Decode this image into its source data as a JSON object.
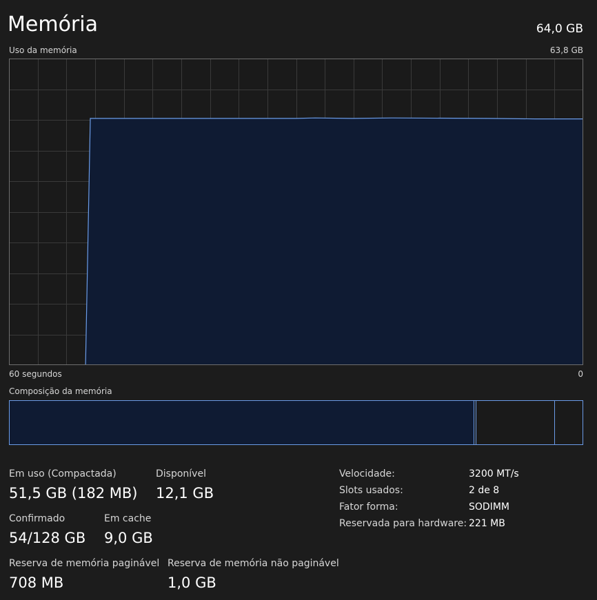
{
  "header": {
    "title": "Memória",
    "total": "64,0 GB"
  },
  "usage_graph": {
    "label": "Uso da memória",
    "max_label": "63,8 GB",
    "time_start": "60 segundos",
    "time_end": "0"
  },
  "composition": {
    "label": "Composição da memória"
  },
  "stats": {
    "in_use_label": "Em uso (Compactada)",
    "in_use_value": "51,5 GB (182 MB)",
    "available_label": "Disponível",
    "available_value": "12,1 GB",
    "committed_label": "Confirmado",
    "committed_value": "54/128 GB",
    "cached_label": "Em cache",
    "cached_value": "9,0 GB",
    "paged_pool_label": "Reserva de memória paginável",
    "paged_pool_value": "708 MB",
    "nonpaged_pool_label": "Reserva de memória não paginável",
    "nonpaged_pool_value": "1,0 GB"
  },
  "properties": [
    {
      "label": "Velocidade:",
      "value": "3200 MT/s"
    },
    {
      "label": "Slots usados:",
      "value": "2 de 8"
    },
    {
      "label": "Fator forma:",
      "value": "SODIMM"
    },
    {
      "label": "Reservada para hardware:",
      "value": "221 MB"
    }
  ],
  "colors": {
    "background": "#1c1c1c",
    "grid": "#3a3a3a",
    "accent_line": "#6b9ce8",
    "accent_fill": "#0f1b33"
  },
  "chart_data": {
    "type": "area",
    "x": [
      60,
      52,
      51.5,
      50,
      40,
      30,
      28,
      24,
      20,
      10,
      5,
      0
    ],
    "values": [
      0,
      0,
      51.5,
      51.5,
      51.5,
      51.5,
      51.6,
      51.5,
      51.6,
      51.5,
      51.4,
      51.4
    ],
    "xlabel": "",
    "ylabel": "",
    "xlim": [
      60,
      0
    ],
    "ylim": [
      0,
      64
    ],
    "grid": true
  }
}
